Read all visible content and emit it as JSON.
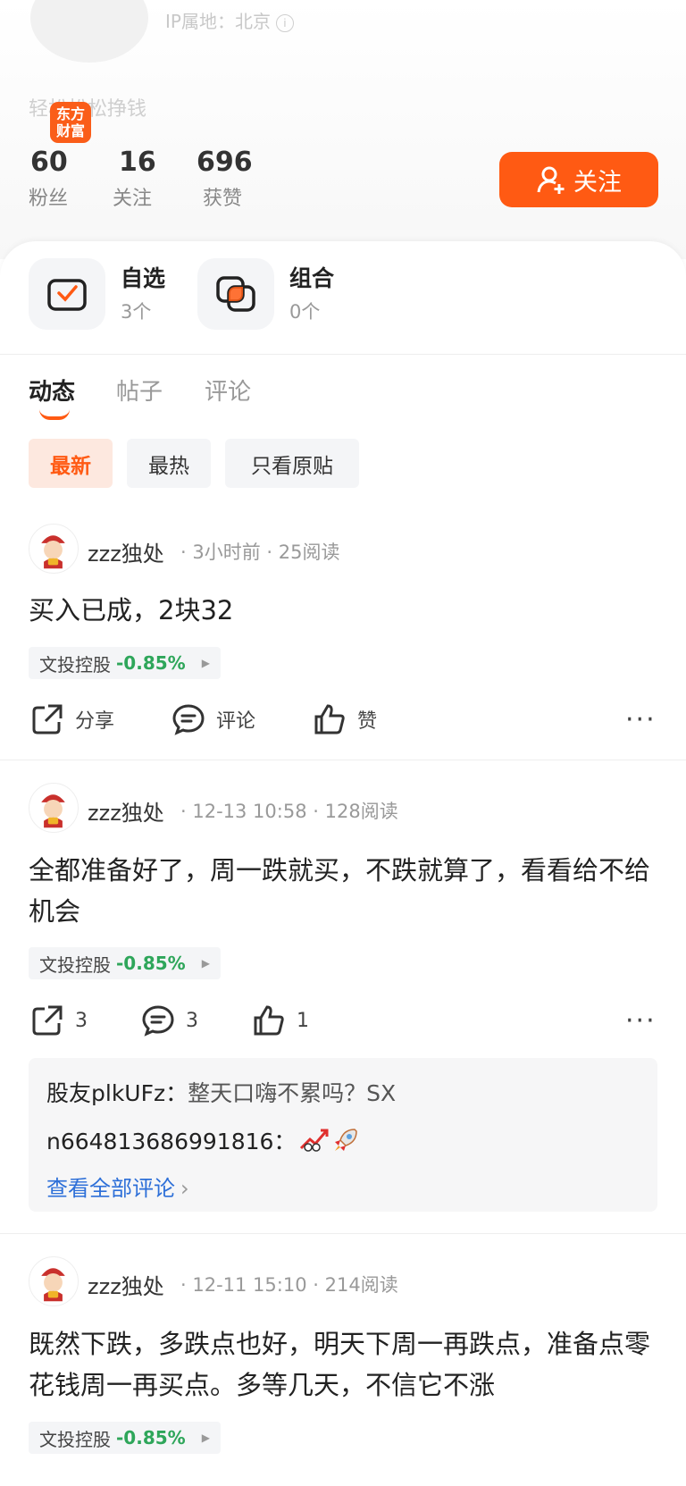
{
  "profile": {
    "ip_location": "IP属地：北京",
    "slogan": "轻松松松挣钱",
    "brand_logo": "东方财富",
    "stats": [
      {
        "value": "60",
        "label": "粉丝"
      },
      {
        "value": "16",
        "label": "关注"
      },
      {
        "value": "696",
        "label": "获赞"
      }
    ],
    "follow_label": "关注"
  },
  "assets": [
    {
      "title": "自选",
      "sub": "3个"
    },
    {
      "title": "组合",
      "sub": "0个"
    }
  ],
  "tabs": [
    "动态",
    "帖子",
    "评论"
  ],
  "filters": [
    "最新",
    "最热",
    "只看原贴"
  ],
  "posts": [
    {
      "author": "zzz独处",
      "time": "3小时前",
      "reads": "25阅读",
      "text": "买入已成，2块32",
      "stock": "文投控股",
      "change": "-0.85%",
      "share": "分享",
      "comment": "评论",
      "like": "赞"
    },
    {
      "author": "zzz独处",
      "time": "12-13 10:58",
      "reads": "128阅读",
      "text": "全都准备好了，周一跌就买，不跌就算了，看看给不给机会",
      "stock": "文投控股",
      "change": "-0.85%",
      "share": "3",
      "comment": "3",
      "like": "1",
      "comments": [
        {
          "user": "股友plkUFz：",
          "text": "整天口嗨不累吗？SX"
        },
        {
          "user": "n664813686991816：",
          "text": ""
        }
      ],
      "view_all": "查看全部评论"
    },
    {
      "author": "zzz独处",
      "time": "12-11 15:10",
      "reads": "214阅读",
      "text": "既然下跌，多跌点也好，明天下周一再跌点，准备点零花钱周一再买点。多等几天，不信它不涨",
      "stock": "文投控股",
      "change": "-0.85%"
    }
  ],
  "colors": {
    "accent": "#ff5a13",
    "down": "#2ea65a",
    "link": "#2d6fd8"
  }
}
